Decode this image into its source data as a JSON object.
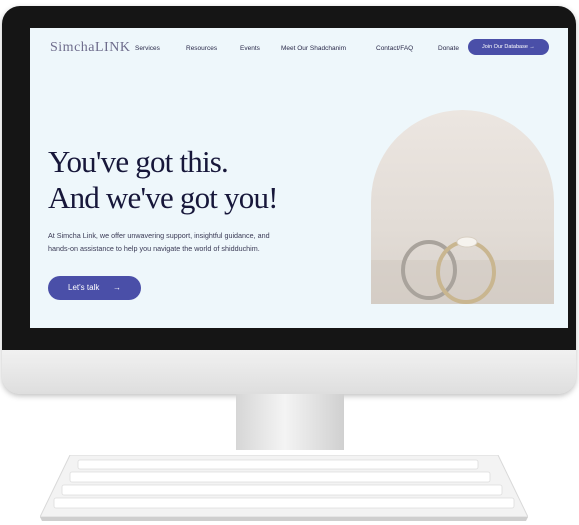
{
  "logo": "SimchaLINK",
  "nav": {
    "items": [
      "Services",
      "Resources",
      "Events",
      "Meet Our Shadchanim",
      "Contact/FAQ",
      "Donate"
    ],
    "cta": "Join Our Database →"
  },
  "hero": {
    "headline": [
      "You've got this.",
      "And we've got you!"
    ],
    "body": [
      "At Simcha Link, we offer unwavering support, insightful guidance, and",
      "hands-on assistance to help you navigate the world of shidduchim."
    ],
    "button_label": "Let's talk",
    "button_icon": "arrow-right-icon",
    "image": "wedding-rings-image"
  },
  "colors": {
    "accent": "#4a4fa8",
    "heading": "#17173a",
    "screen_bg": "#eef7fb"
  }
}
